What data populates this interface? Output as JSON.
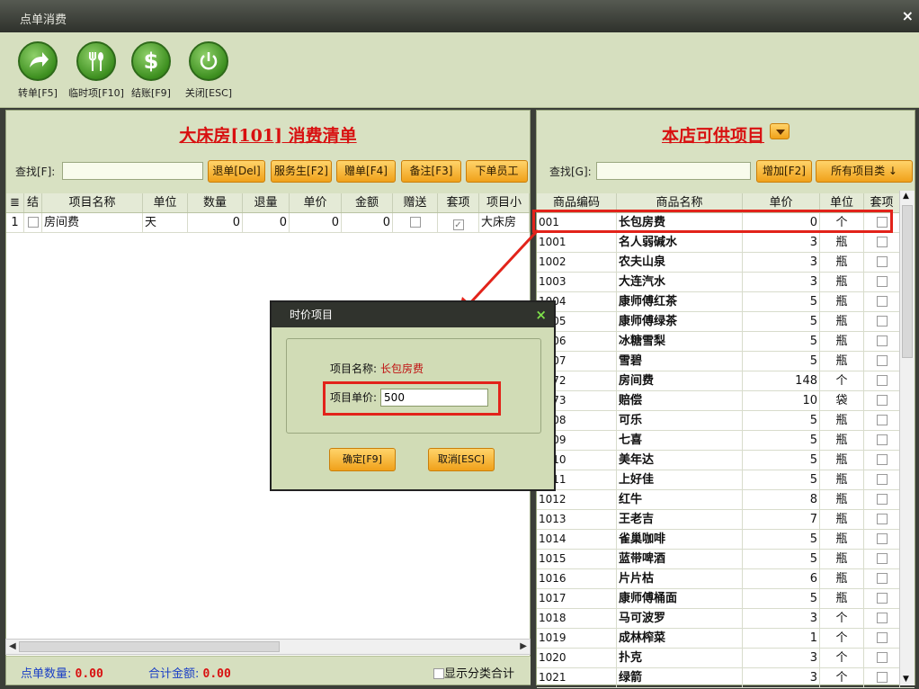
{
  "window": {
    "title": "点单消费",
    "close": "×"
  },
  "toolbar": [
    {
      "label": "转单[F5]",
      "icon": "arrow-icon"
    },
    {
      "label": "临时项[F10]",
      "icon": "fork-spoon-icon"
    },
    {
      "label": "结账[F9]",
      "icon": "dollar-icon"
    },
    {
      "label": "关闭[ESC]",
      "icon": "power-icon"
    }
  ],
  "left": {
    "title": "大床房[101] 消费清单",
    "find_label": "查找[F]:",
    "find_value": "",
    "buttons": [
      "退单[Del]",
      "服务生[F2]",
      "赠单[F4]",
      "备注[F3]",
      "下单员工"
    ],
    "columns": [
      "结",
      "项目名称",
      "单位",
      "数量",
      "退量",
      "单价",
      "金额",
      "赠送",
      "套项",
      "项目小"
    ],
    "rows": [
      {
        "no": "1",
        "name": "房间费",
        "unit": "天",
        "qty": "0",
        "ret": "0",
        "price": "0",
        "amount": "0",
        "gift": false,
        "pkg": true,
        "room": "大床房"
      }
    ],
    "footer": {
      "count_label": "点单数量:",
      "count_value": "0.00",
      "total_label": "合计金额:",
      "total_value": "0.00",
      "category_checkbox": "显示分类合计"
    }
  },
  "right": {
    "title": "本店可供项目",
    "find_label": "查找[G]:",
    "find_value": "",
    "add_button": "增加[F2]",
    "category_button": "所有项目类 ↓",
    "columns": [
      "商品编码",
      "商品名称",
      "单价",
      "单位",
      "套项"
    ],
    "rows": [
      {
        "code": "001",
        "name": "长包房费",
        "price": "0",
        "unit": "个"
      },
      {
        "code": "1001",
        "name": "名人弱碱水",
        "price": "3",
        "unit": "瓶"
      },
      {
        "code": "1002",
        "name": "农夫山泉",
        "price": "3",
        "unit": "瓶"
      },
      {
        "code": "1003",
        "name": "大连汽水",
        "price": "3",
        "unit": "瓶"
      },
      {
        "code": "1004",
        "name": "康师傅红茶",
        "price": "5",
        "unit": "瓶"
      },
      {
        "code": "1005",
        "name": "康师傅绿茶",
        "price": "5",
        "unit": "瓶"
      },
      {
        "code": "1006",
        "name": "冰糖雪梨",
        "price": "5",
        "unit": "瓶"
      },
      {
        "code": "1007",
        "name": "雪碧",
        "price": "5",
        "unit": "瓶"
      },
      {
        "code": "1072",
        "name": "房间费",
        "price": "148",
        "unit": "个"
      },
      {
        "code": "1073",
        "name": "赔偿",
        "price": "10",
        "unit": "袋"
      },
      {
        "code": "1008",
        "name": "可乐",
        "price": "5",
        "unit": "瓶"
      },
      {
        "code": "1009",
        "name": "七喜",
        "price": "5",
        "unit": "瓶"
      },
      {
        "code": "1010",
        "name": "美年达",
        "price": "5",
        "unit": "瓶"
      },
      {
        "code": "1011",
        "name": "上好佳",
        "price": "5",
        "unit": "瓶"
      },
      {
        "code": "1012",
        "name": "红牛",
        "price": "8",
        "unit": "瓶"
      },
      {
        "code": "1013",
        "name": "王老吉",
        "price": "7",
        "unit": "瓶"
      },
      {
        "code": "1014",
        "name": "雀巢咖啡",
        "price": "5",
        "unit": "瓶"
      },
      {
        "code": "1015",
        "name": "蓝带啤酒",
        "price": "5",
        "unit": "瓶"
      },
      {
        "code": "1016",
        "name": "片片枯",
        "price": "6",
        "unit": "瓶"
      },
      {
        "code": "1017",
        "name": "康师傅桶面",
        "price": "5",
        "unit": "瓶"
      },
      {
        "code": "1018",
        "name": "马可波罗",
        "price": "3",
        "unit": "个"
      },
      {
        "code": "1019",
        "name": "成林榨菜",
        "price": "1",
        "unit": "个"
      },
      {
        "code": "1020",
        "name": "扑克",
        "price": "3",
        "unit": "个"
      },
      {
        "code": "1021",
        "name": "绿箭",
        "price": "3",
        "unit": "个"
      }
    ]
  },
  "dialog": {
    "title": "时价项目",
    "close": "×",
    "name_label": "项目名称:",
    "name_value": "长包房费",
    "price_label": "项目单价:",
    "price_value": "500",
    "ok": "确定[F9]",
    "cancel": "取消[ESC]"
  },
  "colors": {
    "accent": "#f0a11a",
    "title_red": "#d81010",
    "panel_bg": "#d6dfbf",
    "highlight": "#e2231a"
  }
}
